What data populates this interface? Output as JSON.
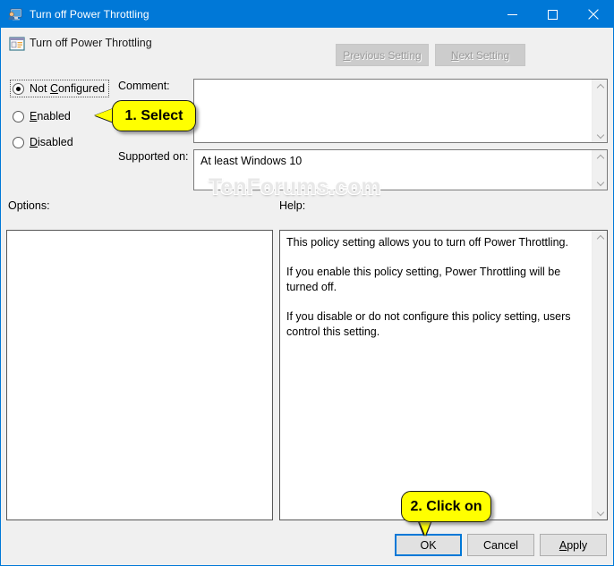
{
  "window": {
    "title": "Turn off Power Throttling",
    "title_icon": "policy-user-monitor-icon",
    "accent_color": "#0078d7",
    "background_color": "#f0f0f0",
    "caption_buttons": {
      "minimize": "minimize-icon",
      "maximize": "maximize-icon",
      "close": "close-icon"
    }
  },
  "header": {
    "icon": "policy-setting-icon",
    "policy_title": "Turn off Power Throttling",
    "previous_setting_label": "Previous Setting",
    "previous_setting_accel": "P",
    "next_setting_label": "Next Setting",
    "next_setting_accel": "N",
    "buttons_enabled": false
  },
  "state_options": {
    "selected": "Not Configured",
    "items": [
      {
        "label": "Not Configured",
        "accel": "C",
        "checked": true,
        "focused": true
      },
      {
        "label": "Enabled",
        "accel": "E",
        "checked": false,
        "focused": false
      },
      {
        "label": "Disabled",
        "accel": "D",
        "checked": false,
        "focused": false
      }
    ]
  },
  "comment": {
    "label": "Comment:",
    "value": "",
    "placeholder": ""
  },
  "supported_on": {
    "label": "Supported on:",
    "value": "At least Windows 10"
  },
  "panels": {
    "options_label": "Options:",
    "options_content": "",
    "help_label": "Help:",
    "help_paragraphs": [
      "This policy setting allows you to turn off Power Throttling.",
      "If you enable this policy setting, Power Throttling will be turned off.",
      "If you disable or do not configure this policy setting, users control this setting."
    ]
  },
  "footer": {
    "ok_label": "OK",
    "ok_is_default": true,
    "cancel_label": "Cancel",
    "apply_label": "Apply",
    "apply_accel": "A"
  },
  "watermark": {
    "text": "TenForums.com"
  },
  "callouts": [
    {
      "id": "step-1",
      "text": "1. Select",
      "points_to": "state-options-radio-group",
      "direction": "left"
    },
    {
      "id": "step-2",
      "text": "2. Click on",
      "points_to": "ok-button",
      "direction": "down"
    }
  ]
}
